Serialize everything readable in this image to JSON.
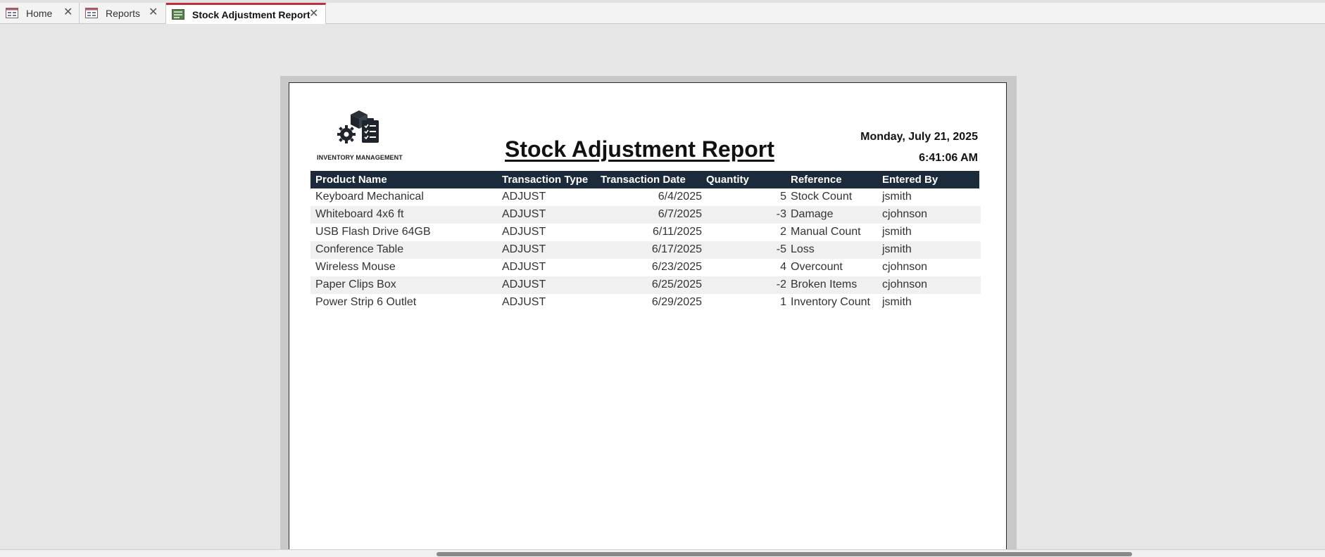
{
  "tabs": [
    {
      "label": "Home",
      "icon": "form-icon"
    },
    {
      "label": "Reports",
      "icon": "form-icon"
    },
    {
      "label": "Stock Adjustment Report",
      "icon": "report-icon",
      "active": true
    }
  ],
  "report": {
    "logo_caption": "INVENTORY MANAGEMENT",
    "title": "Stock Adjustment Report",
    "date": "Monday, July 21, 2025",
    "time": "6:41:06 AM",
    "columns": [
      "Product Name",
      "Transaction Type",
      "Transaction Date",
      "Quantity",
      "Reference",
      "Entered By"
    ],
    "rows": [
      {
        "product": "Keyboard Mechanical",
        "type": "ADJUST",
        "date": "6/4/2025",
        "qty": "5",
        "reference": "Stock Count",
        "entered_by": "jsmith"
      },
      {
        "product": "Whiteboard 4x6 ft",
        "type": "ADJUST",
        "date": "6/7/2025",
        "qty": "-3",
        "reference": "Damage",
        "entered_by": "cjohnson"
      },
      {
        "product": "USB Flash Drive 64GB",
        "type": "ADJUST",
        "date": "6/11/2025",
        "qty": "2",
        "reference": "Manual Count",
        "entered_by": "jsmith"
      },
      {
        "product": "Conference Table",
        "type": "ADJUST",
        "date": "6/17/2025",
        "qty": "-5",
        "reference": "Loss",
        "entered_by": "jsmith"
      },
      {
        "product": "Wireless Mouse",
        "type": "ADJUST",
        "date": "6/23/2025",
        "qty": "4",
        "reference": "Overcount",
        "entered_by": "cjohnson"
      },
      {
        "product": "Paper Clips Box",
        "type": "ADJUST",
        "date": "6/25/2025",
        "qty": "-2",
        "reference": "Broken Items",
        "entered_by": "cjohnson"
      },
      {
        "product": "Power Strip 6 Outlet",
        "type": "ADJUST",
        "date": "6/29/2025",
        "qty": "1",
        "reference": "Inventory Count",
        "entered_by": "jsmith"
      }
    ]
  },
  "colors": {
    "header_bg": "#1c2b3b",
    "active_tab_accent": "#c0313e",
    "alt_row": "#f0f0f0"
  }
}
